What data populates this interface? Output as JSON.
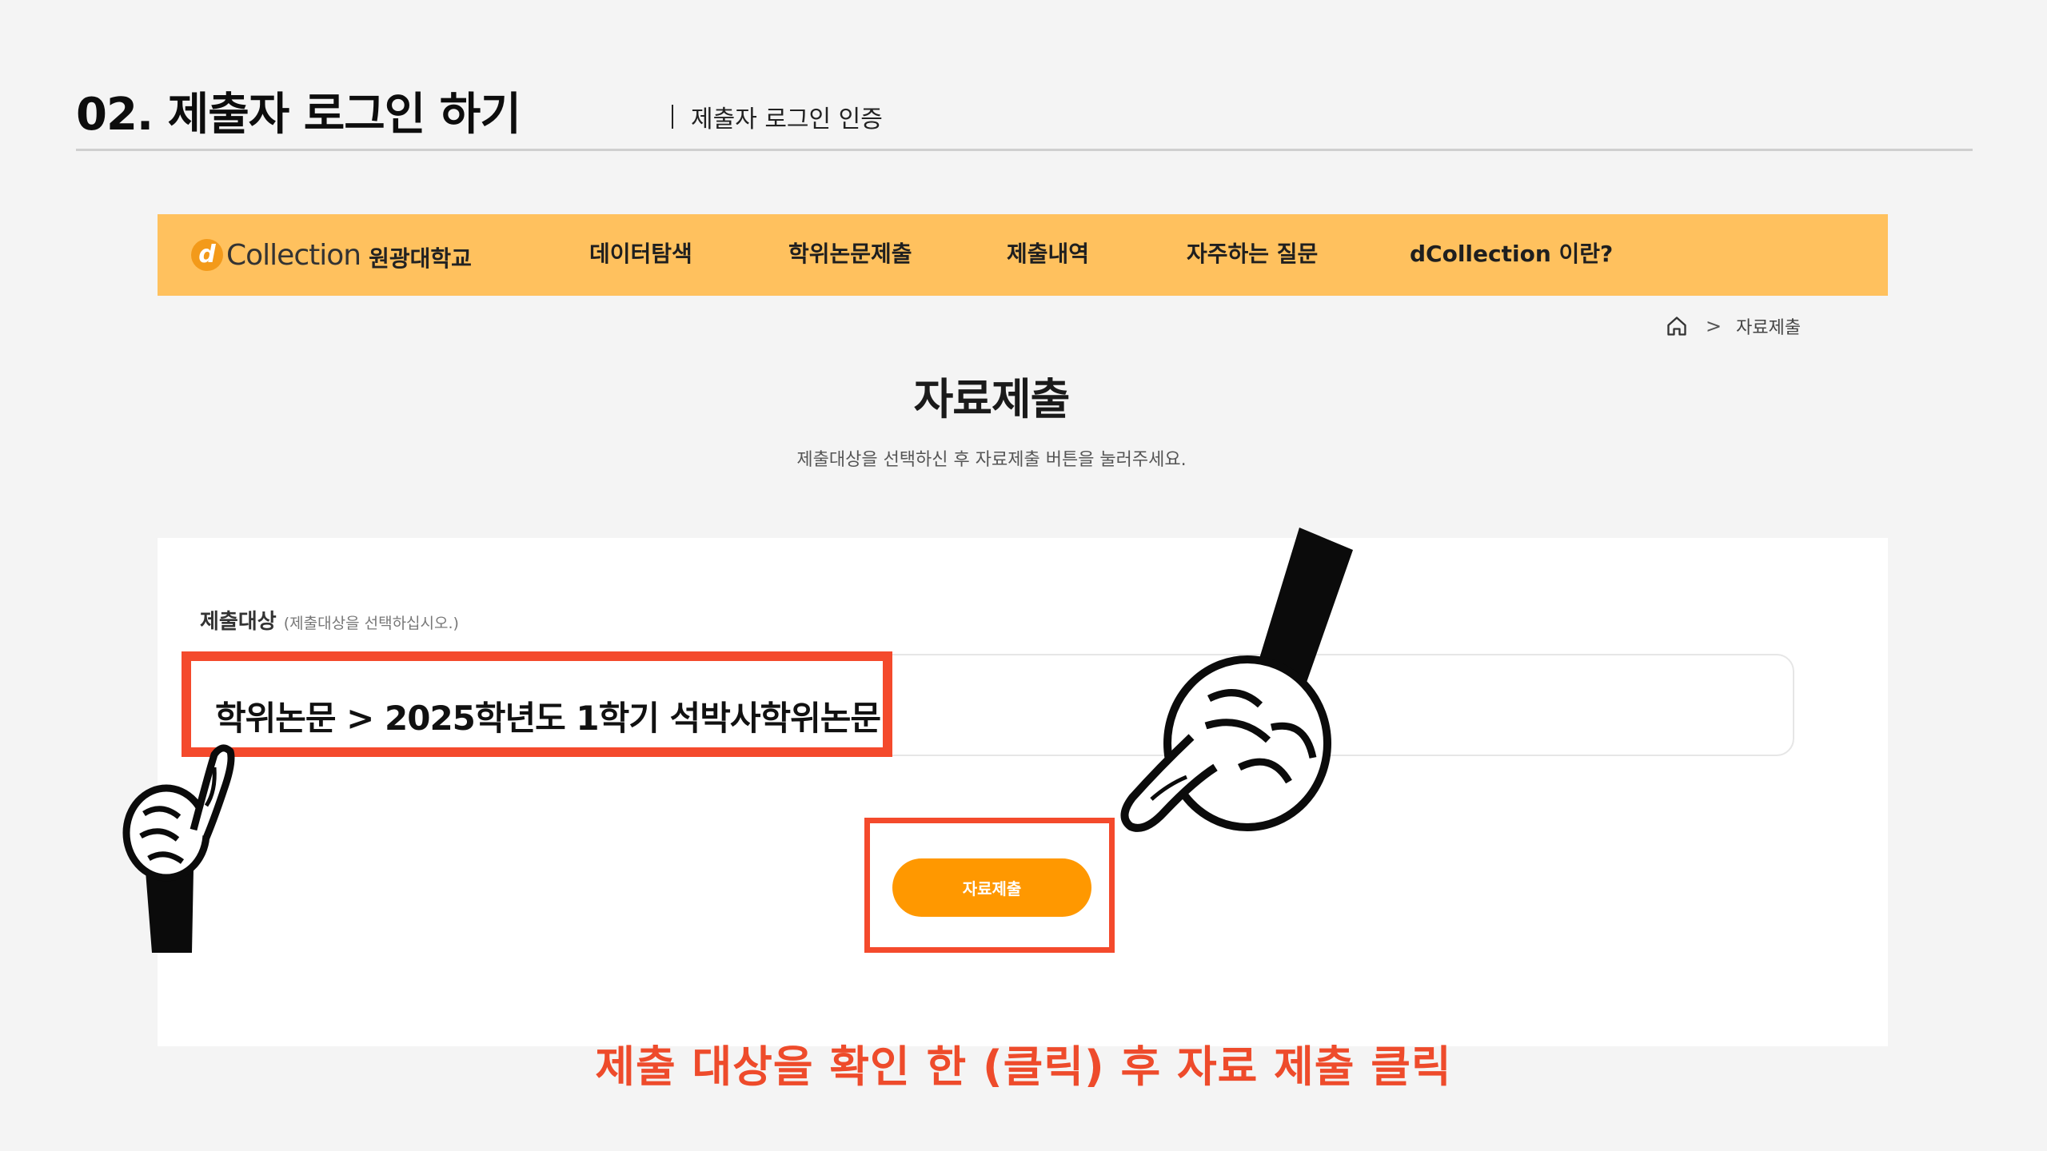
{
  "slide": {
    "title": "02. 제출자 로그인 하기",
    "subtitle": "제출자 로그인 인증",
    "caption": "제출 대상을 확인 한 (클릭) 후 자료 제출 클릭"
  },
  "site": {
    "logo_mark": "d",
    "logo_name": "Collection",
    "logo_university": "원광대학교",
    "nav": [
      "데이터탐색",
      "학위논문제출",
      "제출내역",
      "자주하는 질문",
      "dCollection 이란?"
    ],
    "breadcrumb_sep": ">",
    "breadcrumb_current": "자료제출",
    "page_title": "자료제출",
    "page_description": "제출대상을 선택하신 후 자료제출 버튼을 눌러주세요.",
    "field_label": "제출대상",
    "field_hint": "(제출대상을 선택하십시오.)",
    "selected_target": "학위논문 > 2025학년도 1학기 석박사학위논문",
    "submit_label": "자료제출"
  },
  "colors": {
    "nav_background": "#ffc15e",
    "button": "#ff9800",
    "highlight": "#f44a2c",
    "caption": "#ee4b2b"
  }
}
